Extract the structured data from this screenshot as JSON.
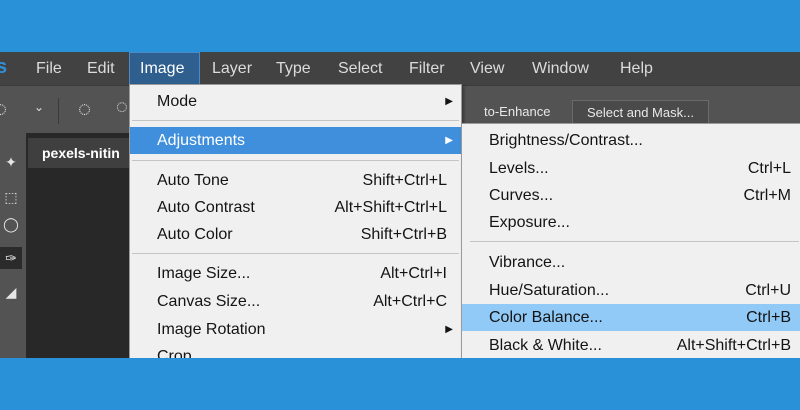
{
  "menubar": {
    "logo": "s",
    "items": [
      "File",
      "Edit",
      "Image",
      "Layer",
      "Type",
      "Select",
      "Filter",
      "View",
      "Window",
      "Help"
    ]
  },
  "options_bar": {
    "auto_enhance": "to-Enhance",
    "select_and_mask": "Select and Mask..."
  },
  "document": {
    "tab_title": "pexels-nitin"
  },
  "image_menu": [
    {
      "label": "Mode",
      "shortcut": "",
      "submenu": true
    },
    {
      "label": "Adjustments",
      "shortcut": "",
      "submenu": true,
      "highlighted": true
    },
    {
      "label": "Auto Tone",
      "shortcut": "Shift+Ctrl+L"
    },
    {
      "label": "Auto Contrast",
      "shortcut": "Alt+Shift+Ctrl+L"
    },
    {
      "label": "Auto Color",
      "shortcut": "Shift+Ctrl+B"
    },
    {
      "label": "Image Size...",
      "shortcut": "Alt+Ctrl+I"
    },
    {
      "label": "Canvas Size...",
      "shortcut": "Alt+Ctrl+C"
    },
    {
      "label": "Image Rotation",
      "shortcut": "",
      "submenu": true
    },
    {
      "label": "Crop",
      "shortcut": ""
    }
  ],
  "adjustments_menu": [
    {
      "label": "Brightness/Contrast...",
      "shortcut": ""
    },
    {
      "label": "Levels...",
      "shortcut": "Ctrl+L"
    },
    {
      "label": "Curves...",
      "shortcut": "Ctrl+M"
    },
    {
      "label": "Exposure...",
      "shortcut": ""
    },
    {
      "label": "Vibrance...",
      "shortcut": ""
    },
    {
      "label": "Hue/Saturation...",
      "shortcut": "Ctrl+U"
    },
    {
      "label": "Color Balance...",
      "shortcut": "Ctrl+B",
      "highlighted": true
    },
    {
      "label": "Black & White...",
      "shortcut": "Alt+Shift+Ctrl+B"
    }
  ],
  "colors": {
    "outer_background": "#2991d7",
    "menu_highlight": "#91c9f7",
    "adjustments_highlight": "#3f8fdc"
  }
}
